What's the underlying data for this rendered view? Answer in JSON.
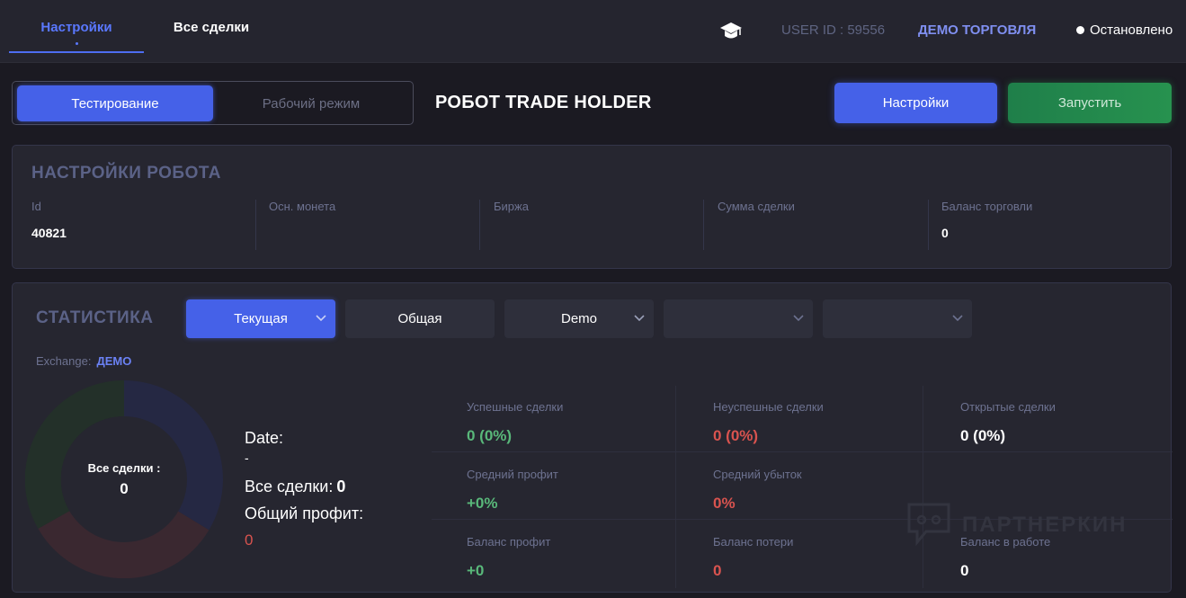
{
  "nav": {
    "tabs": [
      {
        "label": "Настройки",
        "active": true
      },
      {
        "label": "Все сделки",
        "active": false
      }
    ],
    "user_id": "USER ID : 59556",
    "trade_mode": "ДЕМО ТОРГОВЛЯ",
    "status": "Остановлено"
  },
  "mode_switch": {
    "test_label": "Тестирование",
    "work_label": "Рабочий режим"
  },
  "robot_title": "РОБОТ TRADE HOLDER",
  "actions": {
    "settings_label": "Настройки",
    "run_label": "Запустить"
  },
  "robot_settings": {
    "title": "НАСТРОЙКИ РОБОТА",
    "fields": [
      {
        "label": "Id",
        "value": "40821"
      },
      {
        "label": "Осн. монета",
        "value": ""
      },
      {
        "label": "Биржа",
        "value": ""
      },
      {
        "label": "Сумма сделки",
        "value": ""
      },
      {
        "label": "Баланс торговли",
        "value": "0"
      }
    ]
  },
  "statistics": {
    "title": "СТАТИСТИКА",
    "dropdowns": [
      {
        "label": "Текущая",
        "active": true,
        "has_chevron": true
      },
      {
        "label": "Общая",
        "active": false,
        "has_chevron": false
      },
      {
        "label": "Demo",
        "active": false,
        "has_chevron": true
      },
      {
        "label": "",
        "active": false,
        "has_chevron": true
      },
      {
        "label": "",
        "active": false,
        "has_chevron": true
      }
    ],
    "exchange_label": "Exchange:",
    "exchange_value": "ДЕМО",
    "donut": {
      "label": "Все сделки :",
      "value": "0",
      "colors": {
        "blue": "#252843",
        "red": "#3a2830",
        "green": "#233029"
      }
    },
    "summary": {
      "date_label": "Date:",
      "date_value": "-",
      "all_label": "Все сделки:",
      "all_value": "0",
      "profit_label": "Общий профит:",
      "profit_value": "0"
    },
    "cells": [
      {
        "label": "Успешные сделки",
        "value": "0 (0%)",
        "color": "green"
      },
      {
        "label": "Неуспешные сделки",
        "value": "0 (0%)",
        "color": "red"
      },
      {
        "label": "Открытые сделки",
        "value": "0 (0%)",
        "color": "white"
      },
      {
        "label": "Средний профит",
        "value": "+0%",
        "color": "green"
      },
      {
        "label": "Средний убыток",
        "value": "0%",
        "color": "red"
      },
      {
        "label": "",
        "value": "",
        "color": "white"
      },
      {
        "label": "Баланс профит",
        "value": "+0",
        "color": "green"
      },
      {
        "label": "Баланс потери",
        "value": "0",
        "color": "red"
      },
      {
        "label": "Баланс в работе",
        "value": "0",
        "color": "white"
      }
    ]
  },
  "watermark": "ПАРТНЕРКИН",
  "colors": {
    "accent": "#4561e8",
    "run": "#27924f",
    "background": "#1b1a22",
    "card": "#262630"
  }
}
